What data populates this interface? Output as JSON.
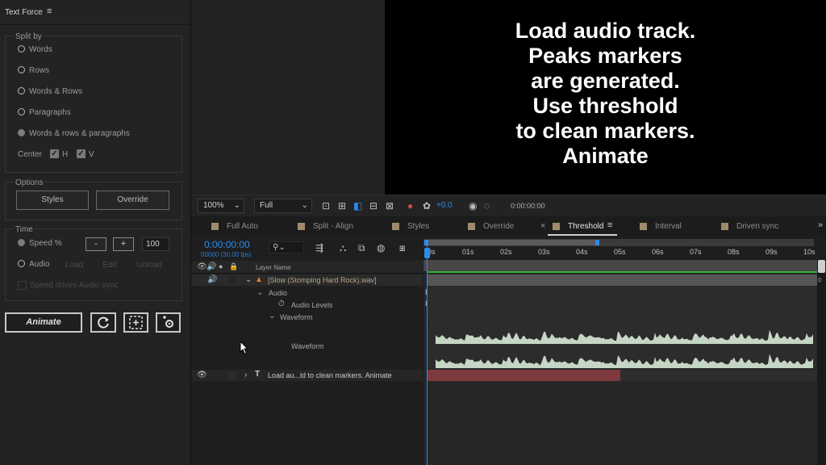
{
  "panel": {
    "title": "Text Force",
    "menu_icon": "hamburger-icon",
    "split_by": {
      "title": "Split by",
      "options": [
        "Words",
        "Rows",
        "Words & Rows",
        "Paragraphs",
        "Words & rows & paragraphs"
      ],
      "selected_index": 4
    },
    "center": {
      "label": "Center",
      "h_label": "H",
      "v_label": "V",
      "h_checked": true,
      "v_checked": true
    },
    "options_group": {
      "title": "Options",
      "styles_label": "Styles",
      "override_label": "Override"
    },
    "time": {
      "title": "Time",
      "speed_label": "Speed %",
      "minus_label": "-",
      "plus_label": "+",
      "speed_value": "100",
      "audio_label": "Audio",
      "load_label": "Load",
      "edit_label": "Edit",
      "unload_label": "Unload",
      "speed_drives_label": "Speed drives Audio sync"
    },
    "animate_label": "Animate"
  },
  "composition": {
    "overlay_text": "Load audio track.\nPeaks markers\nare generated.\nUse threshold\nto clean markers.\nAnimate"
  },
  "viewer_toolbar": {
    "zoom": "100%",
    "resolution": "Full",
    "exposure": "+0.0",
    "timecode": "0:00:00:00"
  },
  "timeline": {
    "tabs": [
      {
        "label": "Full Auto",
        "active": false
      },
      {
        "label": "Split - Align",
        "active": false
      },
      {
        "label": "Styles",
        "active": false
      },
      {
        "label": "Override",
        "active": false
      },
      {
        "label": "Threshold",
        "active": true
      },
      {
        "label": "Interval",
        "active": false
      },
      {
        "label": "Driven sync",
        "active": false
      }
    ],
    "tab_close": "×",
    "more": "»",
    "timecode": "0:00:00:00",
    "fps": "00000 (30.00 fps)",
    "layer_name_header": "Layer Name",
    "ruler_ticks": [
      "0s",
      "01s",
      "02s",
      "03s",
      "04s",
      "05s",
      "06s",
      "07s",
      "08s",
      "09s",
      "10s"
    ],
    "layers": {
      "audio_layer": "[Slow (Stomping Hard Rock).wav]",
      "audio_group": "Audio",
      "audio_levels": "Audio Levels",
      "waveform_group": "Waveform",
      "waveform_label": "Waveform",
      "text_layer": "Load au...ld to clean markers. Animate"
    },
    "colors": {
      "accent_blue": "#2d8ceb",
      "audio_label_color": "#b8a589",
      "text_clip_color": "#7e3a3e",
      "waveform_color": "#c6d6c4"
    }
  }
}
